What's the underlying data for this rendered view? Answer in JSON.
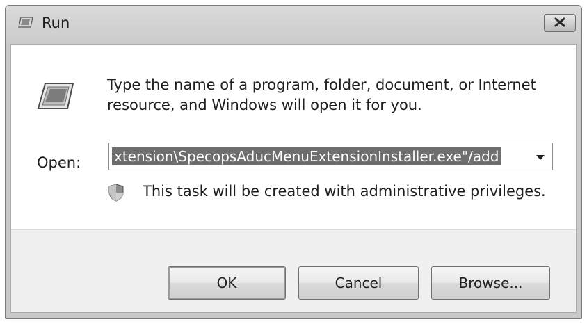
{
  "window": {
    "title": "Run"
  },
  "body": {
    "description": "Type the name of a program, folder, document, or Internet resource, and Windows will open it for you.",
    "open_label": "Open:",
    "open_value": "xtension\\SpecopsAducMenuExtensionInstaller.exe\"/add",
    "admin_notice": "This task will be created with administrative privileges."
  },
  "buttons": {
    "ok": "OK",
    "cancel": "Cancel",
    "browse": "Browse..."
  },
  "icons": {
    "title": "run-icon",
    "main": "run-icon",
    "close": "close-icon",
    "dropdown": "chevron-down-icon",
    "shield": "shield-icon"
  }
}
